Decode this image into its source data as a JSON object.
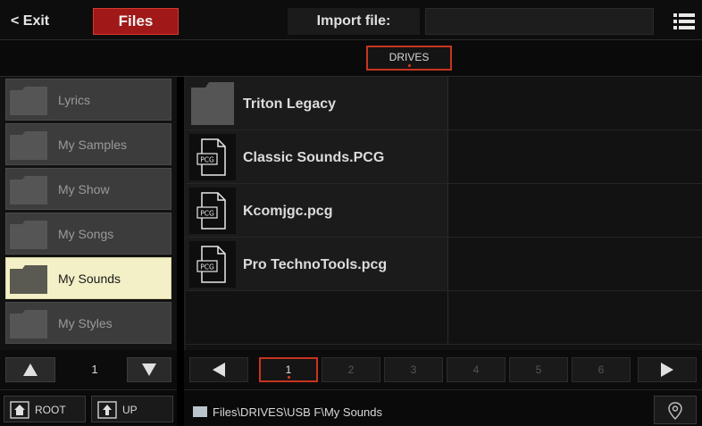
{
  "header": {
    "exit_label": "< Exit",
    "files_tab_label": "Files",
    "import_label": "Import file:",
    "import_value": ""
  },
  "drives": {
    "label": "DRIVES"
  },
  "folders": [
    {
      "label": "Lyrics",
      "selected": false
    },
    {
      "label": "My Samples",
      "selected": false
    },
    {
      "label": "My Show",
      "selected": false
    },
    {
      "label": "My Songs",
      "selected": false
    },
    {
      "label": "My Sounds",
      "selected": true
    },
    {
      "label": "My Styles",
      "selected": false
    }
  ],
  "folder_pager": {
    "page": "1"
  },
  "files": [
    {
      "name": "Triton Legacy",
      "icon": "folder-icon"
    },
    {
      "name": "Classic Sounds.PCG",
      "icon": "pcg-file-icon"
    },
    {
      "name": "Kcomjgc.pcg",
      "icon": "pcg-file-icon"
    },
    {
      "name": "Pro TechnoTools.pcg",
      "icon": "pcg-file-icon"
    }
  ],
  "file_icon_text": "PCG",
  "pages": [
    "1",
    "2",
    "3",
    "4",
    "5",
    "6"
  ],
  "active_page": "1",
  "nav": {
    "root_label": "ROOT",
    "up_label": "UP"
  },
  "path": "Files\\DRIVES\\USB F\\My Sounds",
  "colors": {
    "accent_red": "#c8341f",
    "selected_folder_bg": "#f3efc6",
    "files_tab_bg": "#a01818"
  }
}
